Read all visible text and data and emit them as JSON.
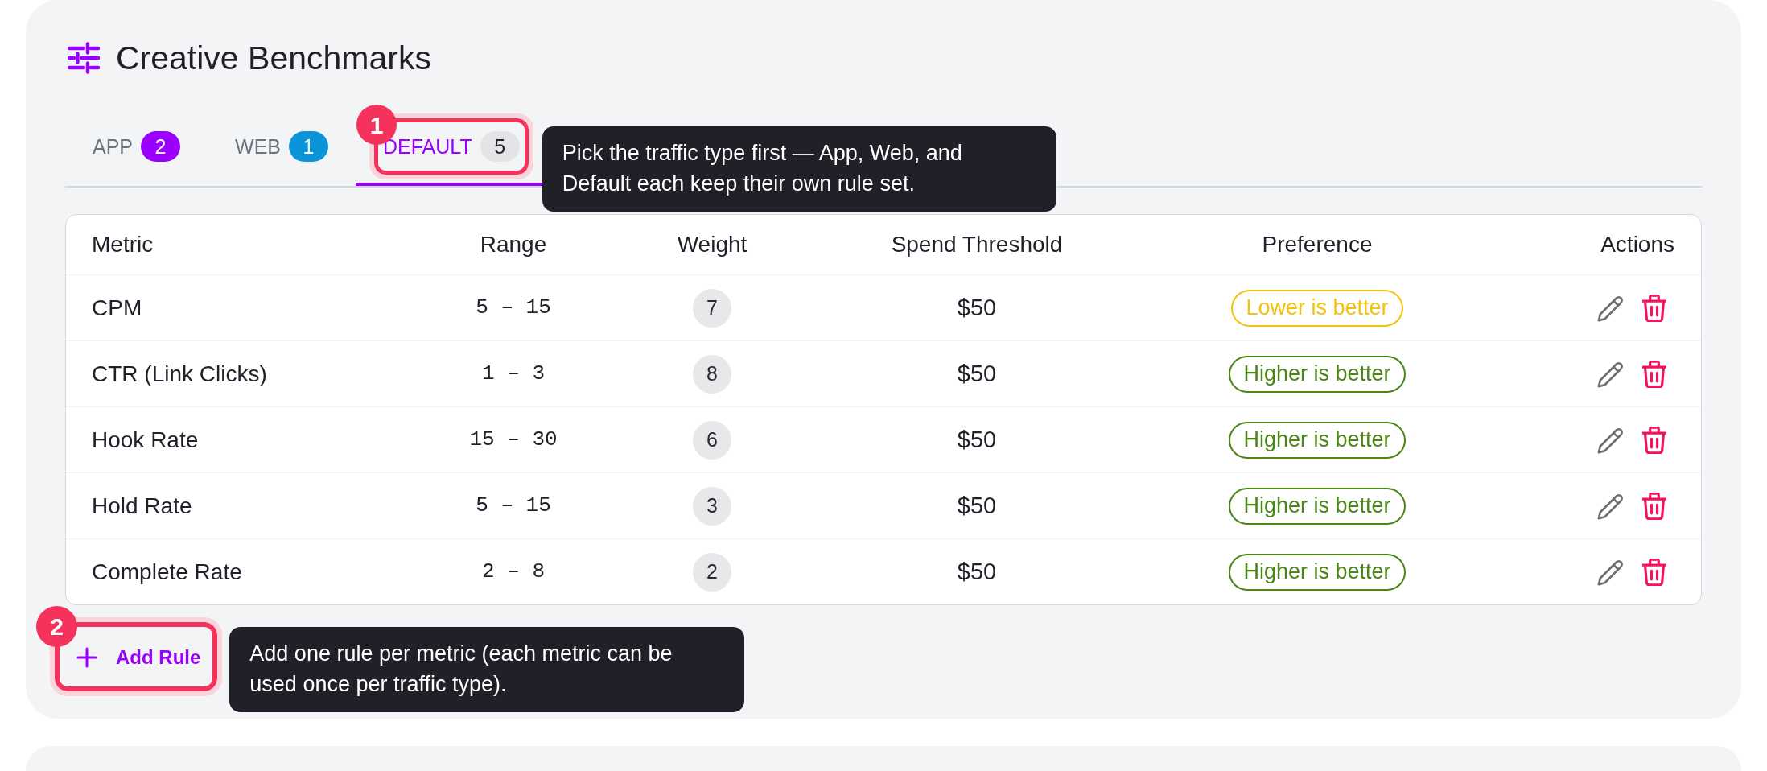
{
  "panel": {
    "title": "Creative Benchmarks"
  },
  "tabs": [
    {
      "label": "APP",
      "count": "2",
      "color": "#9b00ff",
      "selected": false
    },
    {
      "label": "WEB",
      "count": "1",
      "color": "#0b95d8",
      "selected": false
    },
    {
      "label": "DEFAULT",
      "count": "5",
      "color": "#e4e4e7",
      "selected": true,
      "callout": {
        "step": "1",
        "text": "Pick the traffic type first — App, Web, and Default each keep their own rule set."
      }
    }
  ],
  "table": {
    "columns": [
      "Metric",
      "Range",
      "Weight",
      "Spend Threshold",
      "Preference",
      "Actions"
    ],
    "rows": [
      {
        "metric": "CPM",
        "range": "5 – 15",
        "weight": "7",
        "spend_threshold": "$50",
        "preference": {
          "label": "Lower is better",
          "color": "#f4c20d"
        }
      },
      {
        "metric": "CTR (Link Clicks)",
        "range": "1 – 3",
        "weight": "8",
        "spend_threshold": "$50",
        "preference": {
          "label": "Higher is better",
          "color": "#4a8516"
        }
      },
      {
        "metric": "Hook Rate",
        "range": "15 – 30",
        "weight": "6",
        "spend_threshold": "$50",
        "preference": {
          "label": "Higher is better",
          "color": "#4a8516"
        }
      },
      {
        "metric": "Hold Rate",
        "range": "5 – 15",
        "weight": "3",
        "spend_threshold": "$50",
        "preference": {
          "label": "Higher is better",
          "color": "#4a8516"
        }
      },
      {
        "metric": "Complete Rate",
        "range": "2 – 8",
        "weight": "2",
        "spend_threshold": "$50",
        "preference": {
          "label": "Higher is better",
          "color": "#4a8516"
        }
      }
    ]
  },
  "add_rule_button": {
    "label": "Add Rule",
    "callout": {
      "step": "2",
      "text": "Add one rule per metric (each metric can be used once per traffic type)."
    }
  }
}
